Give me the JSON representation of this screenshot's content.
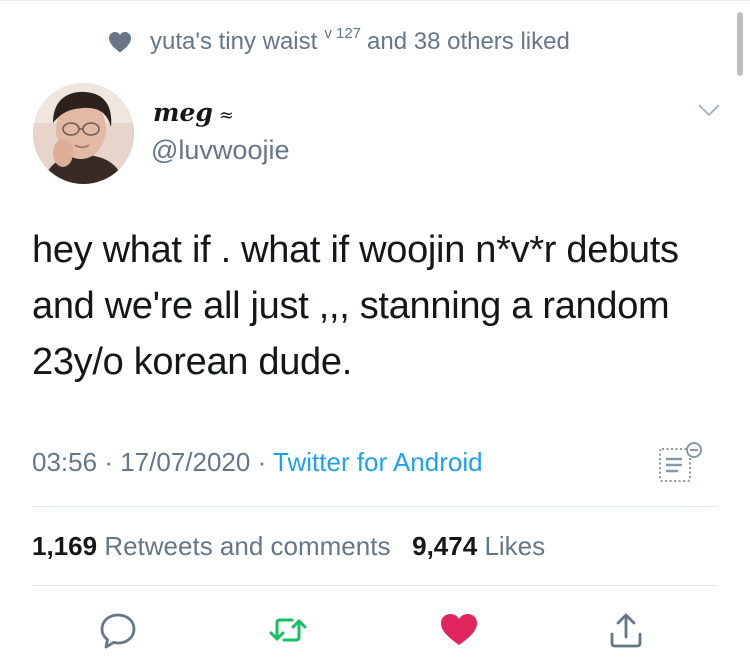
{
  "social_context": {
    "name": "yuta's tiny waist",
    "name_sup": "v 127",
    "suffix": "and 38 others liked"
  },
  "author": {
    "display_name": "meg",
    "name_deco": "≈",
    "handle": "@luvwoojie"
  },
  "tweet": {
    "text": "hey what if . what if woojin n*v*r debuts and we're all just ,,, stanning a random 23y/o korean dude.",
    "time": "03:56",
    "date": "17/07/2020",
    "source": "Twitter for Android"
  },
  "stats": {
    "retweets_count": "1,169",
    "retweets_label": "Retweets and comments",
    "likes_count": "9,474",
    "likes_label": "Likes"
  },
  "colors": {
    "accent": "#1da1f2",
    "muted": "#657786",
    "like": "#e0245e",
    "retweet": "#17bf63"
  },
  "icons": [
    "heart-icon",
    "chevron-down-icon",
    "analytics-icon",
    "reply-icon",
    "retweet-icon",
    "like-icon",
    "share-icon"
  ]
}
